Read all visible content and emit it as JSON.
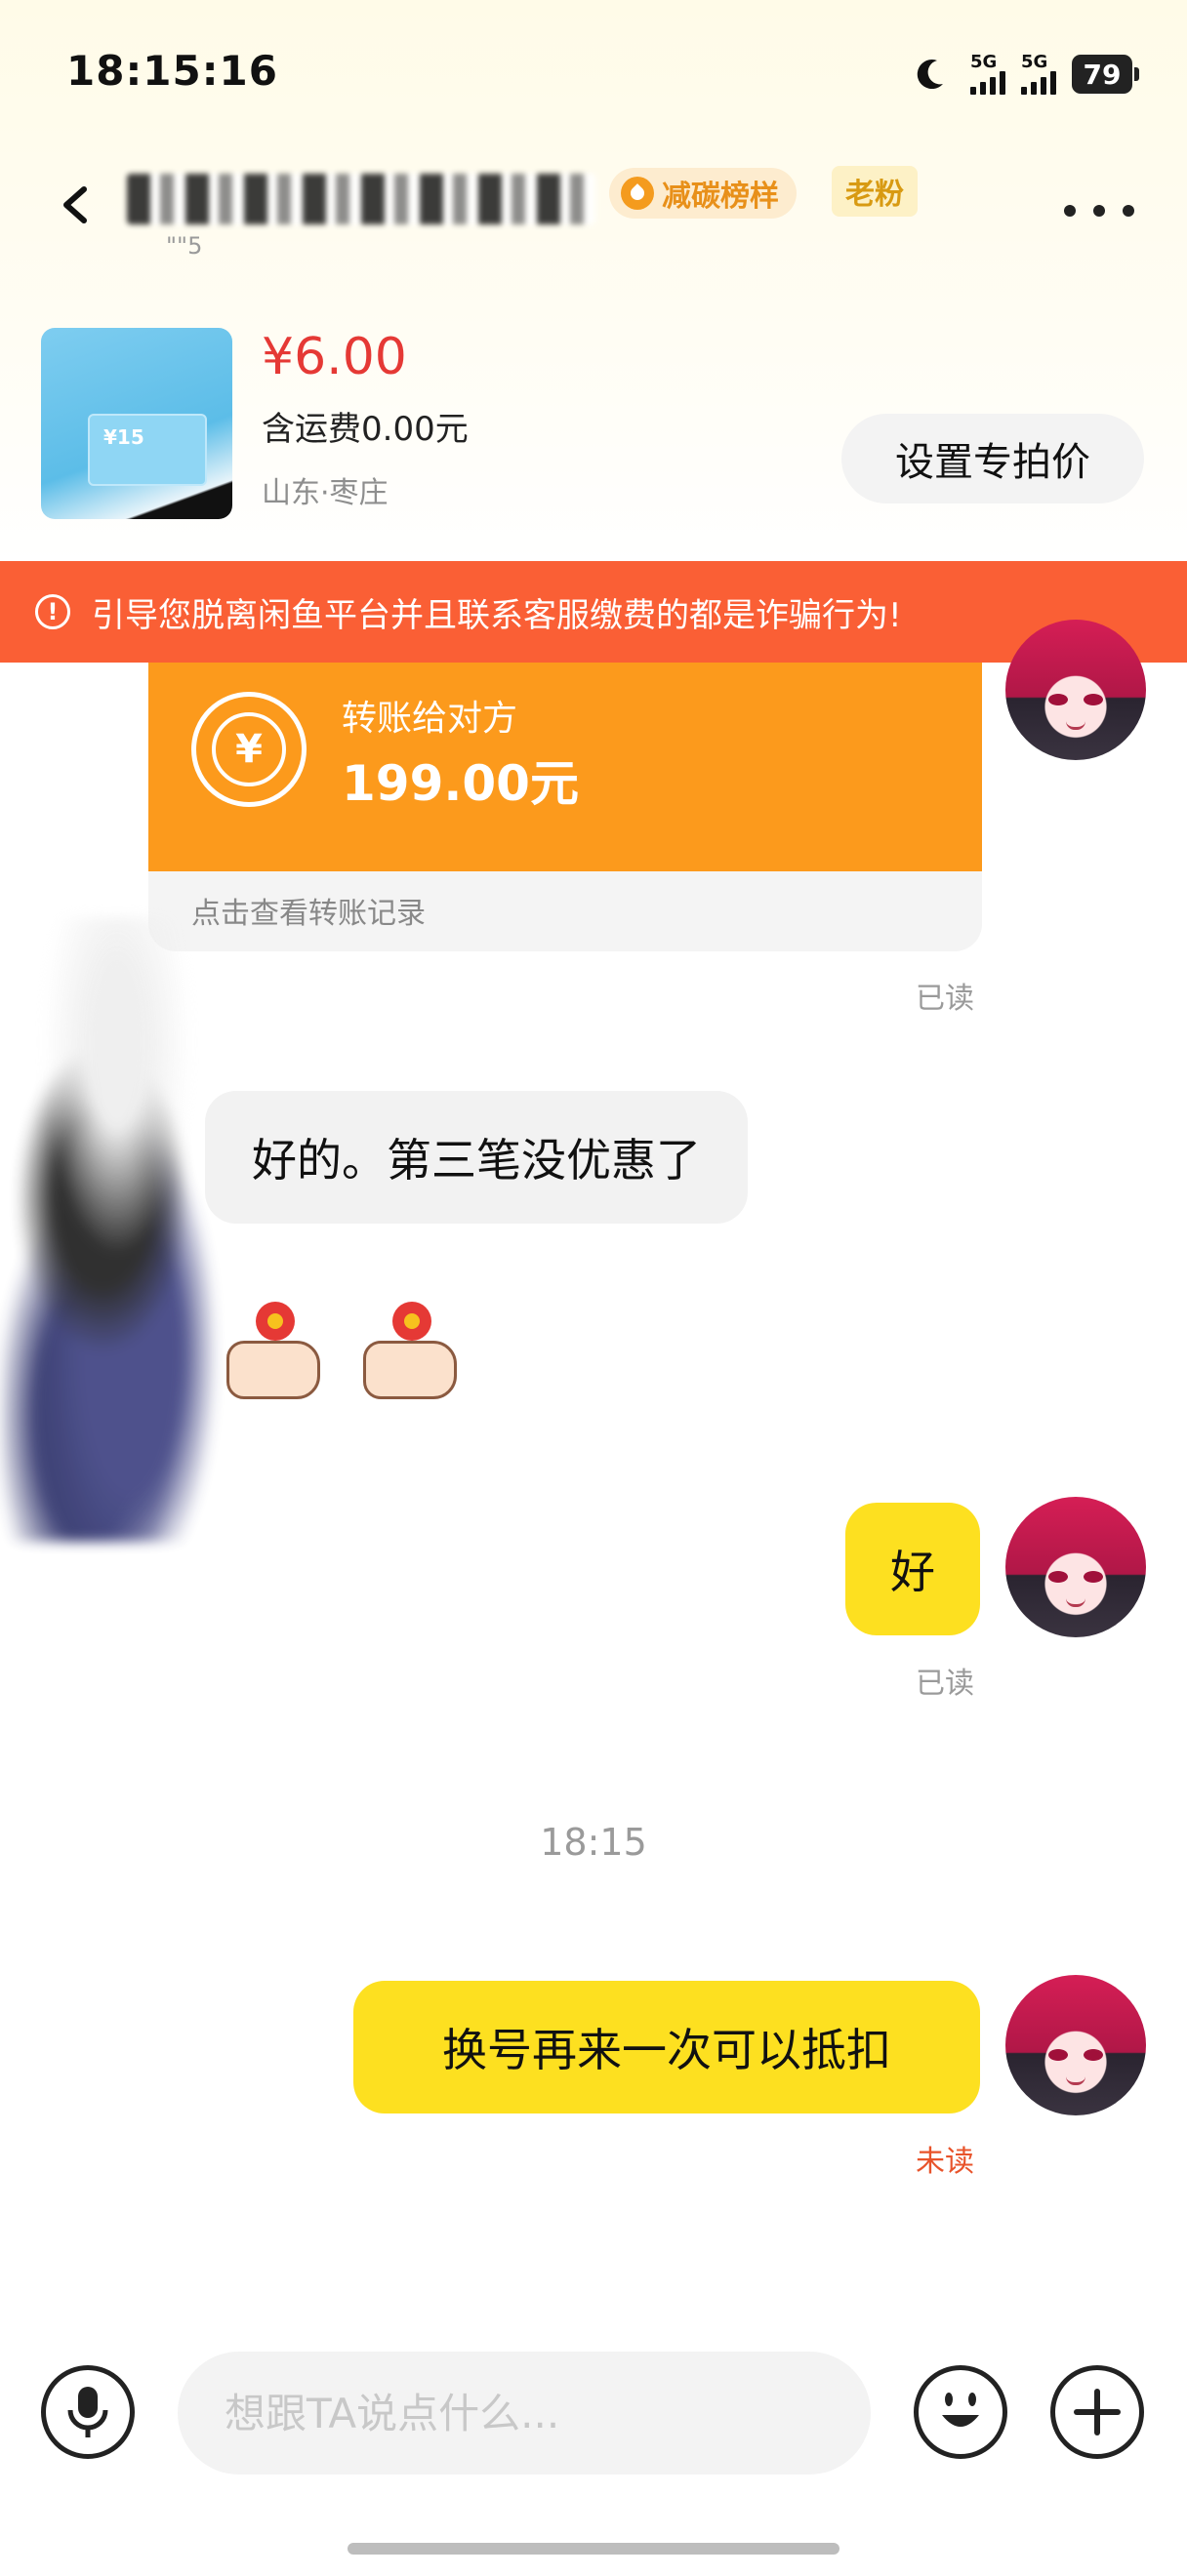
{
  "status_bar": {
    "time": "18:15:16",
    "sim1": "5G",
    "sim2": "5G",
    "battery": "79"
  },
  "header": {
    "sub_text": "\"\"5",
    "badge_carbon": "减碳榜样",
    "badge_fan": "老粉"
  },
  "product": {
    "price": "¥6.00",
    "shipping": "含运费0.00元",
    "location": "山东·枣庄",
    "set_price_button": "设置专拍价",
    "thumb_value": "¥15"
  },
  "warning": {
    "text": "引导您脱离闲鱼平台并且联系客服缴费的都是诈骗行为!"
  },
  "messages": {
    "transfer": {
      "label": "转账给对方",
      "amount": "199.00元",
      "link": "点击查看转账记录",
      "status": "已读"
    },
    "incoming_text": "好的。第三笔没优惠了",
    "outgoing_1": {
      "text": "好",
      "status": "已读"
    },
    "timestamp": "18:15",
    "outgoing_2": {
      "text": "换号再来一次可以抵扣",
      "status": "未读"
    }
  },
  "input_bar": {
    "placeholder": "想跟TA说点什么..."
  },
  "colors": {
    "warning_bg": "#fa5f35",
    "transfer_bg": "#fc9a1c",
    "bubble_yellow": "#fde020",
    "price_red": "#e53935"
  }
}
